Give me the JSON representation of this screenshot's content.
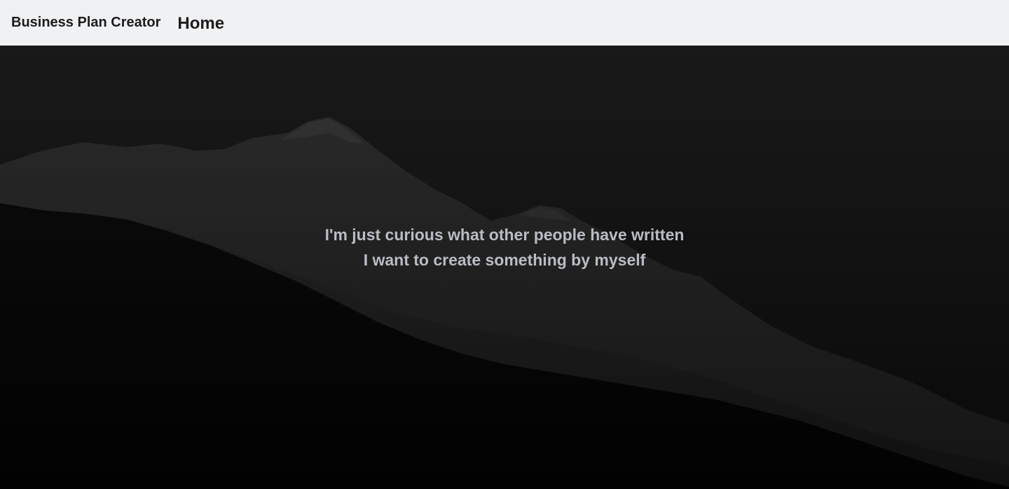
{
  "navbar": {
    "brand": "Business Plan Creator",
    "home_link": "Home"
  },
  "hero": {
    "background": "mountain-silhouette-image",
    "options": [
      "I'm just curious what other people have written",
      "I want to create something by myself"
    ]
  },
  "colors": {
    "navbar_bg": "#f0f1f3",
    "nav_text": "#1c1c1c",
    "hero_text": "#b9bcc4"
  }
}
